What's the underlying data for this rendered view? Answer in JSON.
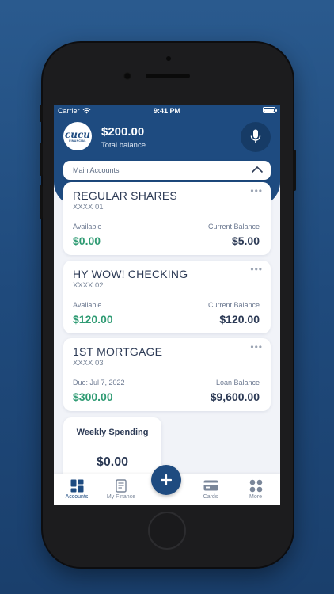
{
  "status_bar": {
    "carrier": "Carrier",
    "time": "9:41 PM"
  },
  "header": {
    "logo_text": "cucu",
    "logo_sub": "FINANCIAL",
    "balance": "$200.00",
    "balance_label": "Total balance"
  },
  "accounts_section": {
    "label": "Main Accounts"
  },
  "accounts": [
    {
      "name": "REGULAR SHARES",
      "number": "XXXX 01",
      "left_label": "Available",
      "left_value": "$0.00",
      "right_label": "Current Balance",
      "right_value": "$5.00"
    },
    {
      "name": "HY WOW! CHECKING",
      "number": "XXXX 02",
      "left_label": "Available",
      "left_value": "$120.00",
      "right_label": "Current Balance",
      "right_value": "$120.00"
    },
    {
      "name": "1ST MORTGAGE",
      "number": "XXXX 03",
      "left_label": "Due: Jul 7, 2022",
      "left_value": "$300.00",
      "right_label": "Loan Balance",
      "right_value": "$9,600.00"
    }
  ],
  "weekly": {
    "title": "Weekly Spending",
    "value": "$0.00"
  },
  "tabs": [
    {
      "label": "Accounts",
      "icon": "grid-icon"
    },
    {
      "label": "My Finance",
      "icon": "document-icon"
    },
    {
      "label": "Cards",
      "icon": "card-icon"
    },
    {
      "label": "More",
      "icon": "dots-grid-icon"
    }
  ],
  "colors": {
    "brand": "#1e4b80",
    "positive": "#2f9b73",
    "text": "#2c3a55"
  }
}
